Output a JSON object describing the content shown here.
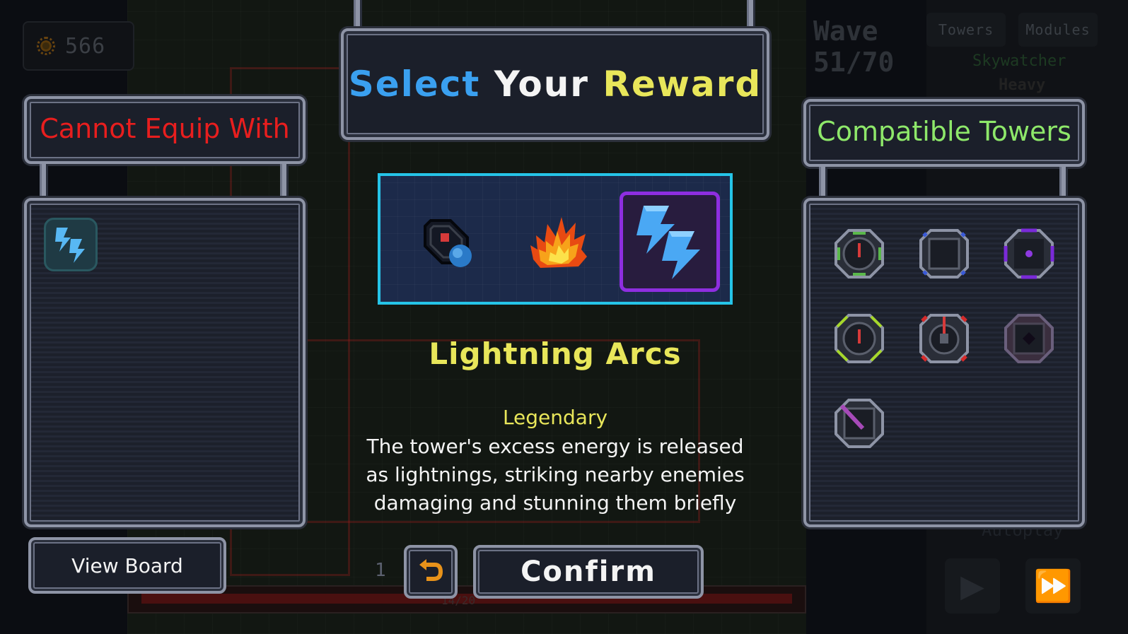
{
  "hud": {
    "gold": "566",
    "wave_label": "Wave",
    "wave_value": "51/70",
    "tabs": [
      "Towers",
      "Modules"
    ],
    "tower_name": "Skywatcher",
    "tower_type": "Heavy",
    "autoplay_label": "Autoplay",
    "progress_text": "14/20"
  },
  "title": {
    "word1": "Select",
    "word2": "Your",
    "word3": "Reward"
  },
  "left_panel": {
    "header": "Cannot Equip With",
    "items": [
      {
        "icon": "lightning-arcs-icon"
      }
    ]
  },
  "right_panel": {
    "header": "Compatible Towers",
    "towers": [
      {
        "icon": "tower-green-icon"
      },
      {
        "icon": "tower-blue-square-icon"
      },
      {
        "icon": "tower-purple-icon"
      },
      {
        "icon": "tower-lime-icon"
      },
      {
        "icon": "tower-red-icon"
      },
      {
        "icon": "tower-dark-purple-icon"
      },
      {
        "icon": "tower-staff-icon"
      }
    ]
  },
  "rewards": [
    {
      "icon": "bomb-module-icon"
    },
    {
      "icon": "fire-module-icon"
    },
    {
      "icon": "lightning-module-icon",
      "selected": true
    }
  ],
  "selected_reward": {
    "name": "Lightning Arcs",
    "rarity": "Legendary",
    "description_lines": [
      "The tower's excess energy is released",
      "as lightnings, striking nearby enemies",
      "damaging and stunning them briefly"
    ]
  },
  "buttons": {
    "view_board": "View Board",
    "confirm": "Confirm",
    "reroll_count": "1"
  },
  "colors": {
    "accent_blue": "#3aa0f0",
    "accent_yellow": "#e8e65a",
    "danger_red": "#e81e1e",
    "success_green": "#8ee86a",
    "selection_purple": "#8e2ee0",
    "reward_border": "#25c4e8"
  }
}
